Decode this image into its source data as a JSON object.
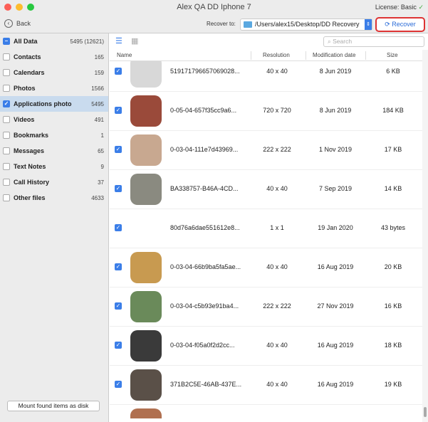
{
  "window": {
    "title": "Alex QA DD Iphone 7",
    "license": "License: Basic"
  },
  "toolbar": {
    "back": "Back",
    "recover_to_label": "Recover to:",
    "recover_path": "/Users/alex15/Desktop/DD Recovery",
    "recover_button": "Recover"
  },
  "sidebar": {
    "items": [
      {
        "label": "All Data",
        "count": "5495 (12621)",
        "state": "partial"
      },
      {
        "label": "Contacts",
        "count": "165",
        "state": "off"
      },
      {
        "label": "Calendars",
        "count": "159",
        "state": "off"
      },
      {
        "label": "Photos",
        "count": "1566",
        "state": "off"
      },
      {
        "label": "Applications photo",
        "count": "5495",
        "state": "on"
      },
      {
        "label": "Videos",
        "count": "491",
        "state": "off"
      },
      {
        "label": "Bookmarks",
        "count": "1",
        "state": "off"
      },
      {
        "label": "Messages",
        "count": "65",
        "state": "off"
      },
      {
        "label": "Text Notes",
        "count": "9",
        "state": "off"
      },
      {
        "label": "Call History",
        "count": "37",
        "state": "off"
      },
      {
        "label": "Other files",
        "count": "4633",
        "state": "off"
      }
    ],
    "mount_button": "Mount found items as disk"
  },
  "search": {
    "placeholder": "Search"
  },
  "table": {
    "headers": {
      "name": "Name",
      "resolution": "Resolution",
      "date": "Modification date",
      "size": "Size"
    },
    "rows": [
      {
        "name": "519171796657069028...",
        "resolution": "40 x 40",
        "date": "8 Jun 2019",
        "size": "6 KB",
        "thumb": "#d8d8d8"
      },
      {
        "name": "0-05-04-657f35cc9a6...",
        "resolution": "720 x 720",
        "date": "8 Jun 2019",
        "size": "184 KB",
        "thumb": "#9a4a3a"
      },
      {
        "name": "0-03-04-111e7d43969...",
        "resolution": "222 x 222",
        "date": "1 Nov 2019",
        "size": "17 KB",
        "thumb": "#c8a890"
      },
      {
        "name": "BA338757-B46A-4CD...",
        "resolution": "40 x 40",
        "date": "7 Sep 2019",
        "size": "14 KB",
        "thumb": "#8a8a80"
      },
      {
        "name": "80d76a6dae551612e8...",
        "resolution": "1 x 1",
        "date": "19 Jan 2020",
        "size": "43 bytes",
        "thumb": ""
      },
      {
        "name": "0-03-04-66b9ba5fa5ae...",
        "resolution": "40 x 40",
        "date": "16 Aug 2019",
        "size": "20 KB",
        "thumb": "#c89a50"
      },
      {
        "name": "0-03-04-c5b93e91ba4...",
        "resolution": "222 x 222",
        "date": "27 Nov 2019",
        "size": "16 KB",
        "thumb": "#6a8a5a"
      },
      {
        "name": "0-03-04-f05a0f2d2cc...",
        "resolution": "40 x 40",
        "date": "16 Aug 2019",
        "size": "18 KB",
        "thumb": "#3a3a3a"
      },
      {
        "name": "371B2C5E-46AB-437E...",
        "resolution": "40 x 40",
        "date": "16 Aug 2019",
        "size": "19 KB",
        "thumb": "#5a5048"
      },
      {
        "name": "",
        "resolution": "",
        "date": "",
        "size": "",
        "thumb": "#b07050"
      }
    ]
  }
}
